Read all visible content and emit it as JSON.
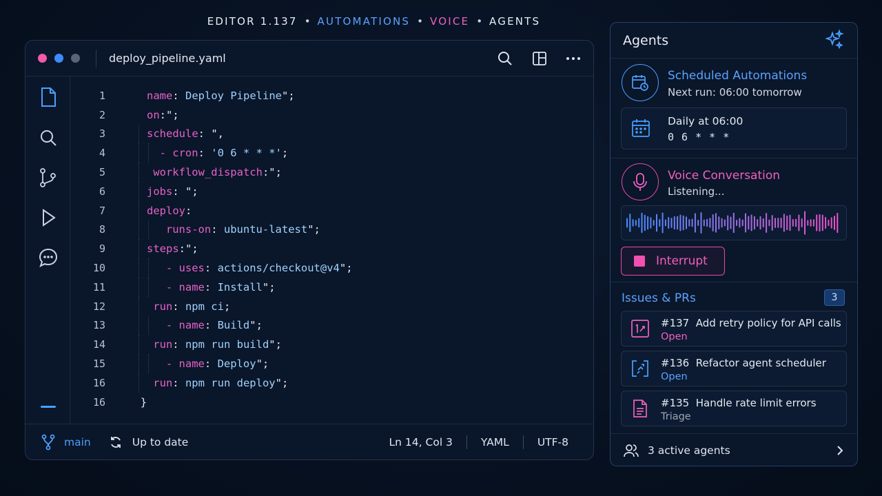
{
  "top_nav": [
    {
      "label": "EDITOR 1.137",
      "color": "#e8edf5"
    },
    {
      "label": "AUTOMATIONS",
      "color": "#5aa2ff"
    },
    {
      "label": "VOICE",
      "color": "#f060c0"
    },
    {
      "label": "AGENTS",
      "color": "#e8edf5"
    }
  ],
  "top_nav_separator": "•",
  "editor": {
    "file_name": "deploy_pipeline.yaml",
    "window_dots": [
      "#f05aa8",
      "#3d8cff",
      "#5a6478"
    ],
    "icons": [
      "search-icon",
      "split-layout-icon",
      "more-icon"
    ],
    "activity_icons": [
      "file-icon",
      "search-icon",
      "source-control-icon",
      "run-icon",
      "chat-icon"
    ],
    "lines": [
      {
        "num": "1",
        "indent": 0,
        "tokens": [
          [
            "name",
            "key"
          ],
          [
            ": ",
            "p"
          ],
          [
            "Deploy Pipeline",
            "str"
          ],
          [
            "\";",
            "p"
          ]
        ]
      },
      {
        "num": "2",
        "indent": 0,
        "tokens": [
          [
            "on",
            "key"
          ],
          [
            ":\";",
            "p"
          ]
        ]
      },
      {
        "num": "3",
        "indent": 0,
        "tokens": [
          [
            "schedule",
            "key"
          ],
          [
            ": \",",
            "p"
          ]
        ]
      },
      {
        "num": "4",
        "indent": 2,
        "tokens": [
          [
            "- cron",
            "key"
          ],
          [
            ": ",
            "p"
          ],
          [
            "'0 6 * * *'",
            "str"
          ],
          [
            ";",
            "p"
          ]
        ]
      },
      {
        "num": "5",
        "indent": 1,
        "tokens": [
          [
            "workflow_dispatch",
            "key"
          ],
          [
            ":\";",
            "p"
          ]
        ]
      },
      {
        "num": "6",
        "indent": 0,
        "tokens": [
          [
            "jobs",
            "key"
          ],
          [
            ": \";",
            "p"
          ]
        ]
      },
      {
        "num": "7",
        "indent": 0,
        "tokens": [
          [
            "deploy",
            "key"
          ],
          [
            ":",
            "p"
          ]
        ]
      },
      {
        "num": "8",
        "indent": 3,
        "tokens": [
          [
            "runs-on",
            "key"
          ],
          [
            ": ",
            "p"
          ],
          [
            "ubuntu-latest",
            "str"
          ],
          [
            "\";",
            "p"
          ]
        ]
      },
      {
        "num": "9",
        "indent": 0,
        "tokens": [
          [
            "steps",
            "key"
          ],
          [
            ":\";",
            "p"
          ]
        ]
      },
      {
        "num": "10",
        "indent": 3,
        "tokens": [
          [
            "- uses",
            "key"
          ],
          [
            ": ",
            "p"
          ],
          [
            "actions/checkout@v4",
            "str"
          ],
          [
            "\";",
            "p"
          ]
        ]
      },
      {
        "num": "11",
        "indent": 3,
        "tokens": [
          [
            "- name",
            "key"
          ],
          [
            ": ",
            "p"
          ],
          [
            "Install",
            "str"
          ],
          [
            "\";",
            "p"
          ]
        ]
      },
      {
        "num": "12",
        "indent": 1,
        "tokens": [
          [
            "run",
            "key"
          ],
          [
            ": ",
            "p"
          ],
          [
            "npm ci",
            "str"
          ],
          [
            ";",
            "p"
          ]
        ]
      },
      {
        "num": "13",
        "indent": 3,
        "tokens": [
          [
            "- name",
            "key"
          ],
          [
            ": ",
            "p"
          ],
          [
            "Build",
            "str"
          ],
          [
            "\";",
            "p"
          ]
        ]
      },
      {
        "num": "14",
        "indent": 1,
        "tokens": [
          [
            "run",
            "key"
          ],
          [
            ": ",
            "p"
          ],
          [
            "npm run build",
            "str"
          ],
          [
            "\";",
            "p"
          ]
        ]
      },
      {
        "num": "15",
        "indent": 3,
        "tokens": [
          [
            "- name",
            "key"
          ],
          [
            ": ",
            "p"
          ],
          [
            "Deploy",
            "str"
          ],
          [
            "\";",
            "p"
          ]
        ]
      },
      {
        "num": "16",
        "indent": 1,
        "tokens": [
          [
            "run",
            "key"
          ],
          [
            ": ",
            "p"
          ],
          [
            "npm run deploy",
            "str"
          ],
          [
            "\";",
            "p"
          ]
        ]
      },
      {
        "num": "16",
        "indent": -1,
        "tokens": [
          [
            "}",
            "p"
          ]
        ]
      }
    ],
    "token_colors": {
      "key": "#e462c8",
      "str": "#9fd2ff",
      "p": "#e2e8f2"
    },
    "status": {
      "branch": "main",
      "sync": "Up to date",
      "cursor": "Ln 14, Col 3",
      "language": "YAML",
      "encoding": "UTF-8"
    }
  },
  "panel": {
    "title": "Agents",
    "automation": {
      "title": "Scheduled Automations",
      "subtitle": "Next run: 06:00 tomorrow",
      "schedule_label": "Daily at 06:00",
      "cron": "0 6 * * *"
    },
    "voice": {
      "title": "Voice Conversation",
      "subtitle": "Listening...",
      "interrupt_label": "Interrupt"
    },
    "issues": {
      "title": "Issues & PRs",
      "count": "3",
      "items": [
        {
          "number": "#137",
          "title": "Add retry policy for API calls",
          "status": "Open",
          "status_color": "#f060c0",
          "icon": "pull-request-icon"
        },
        {
          "number": "#136",
          "title": "Refactor agent scheduler",
          "status": "Open",
          "status_color": "#5aa2ff",
          "icon": "refactor-icon"
        },
        {
          "number": "#135",
          "title": "Handle rate limit errors",
          "status": "Triage",
          "status_color": "#9aa6b8",
          "icon": "document-icon"
        }
      ]
    },
    "footer": "3 active agents"
  }
}
